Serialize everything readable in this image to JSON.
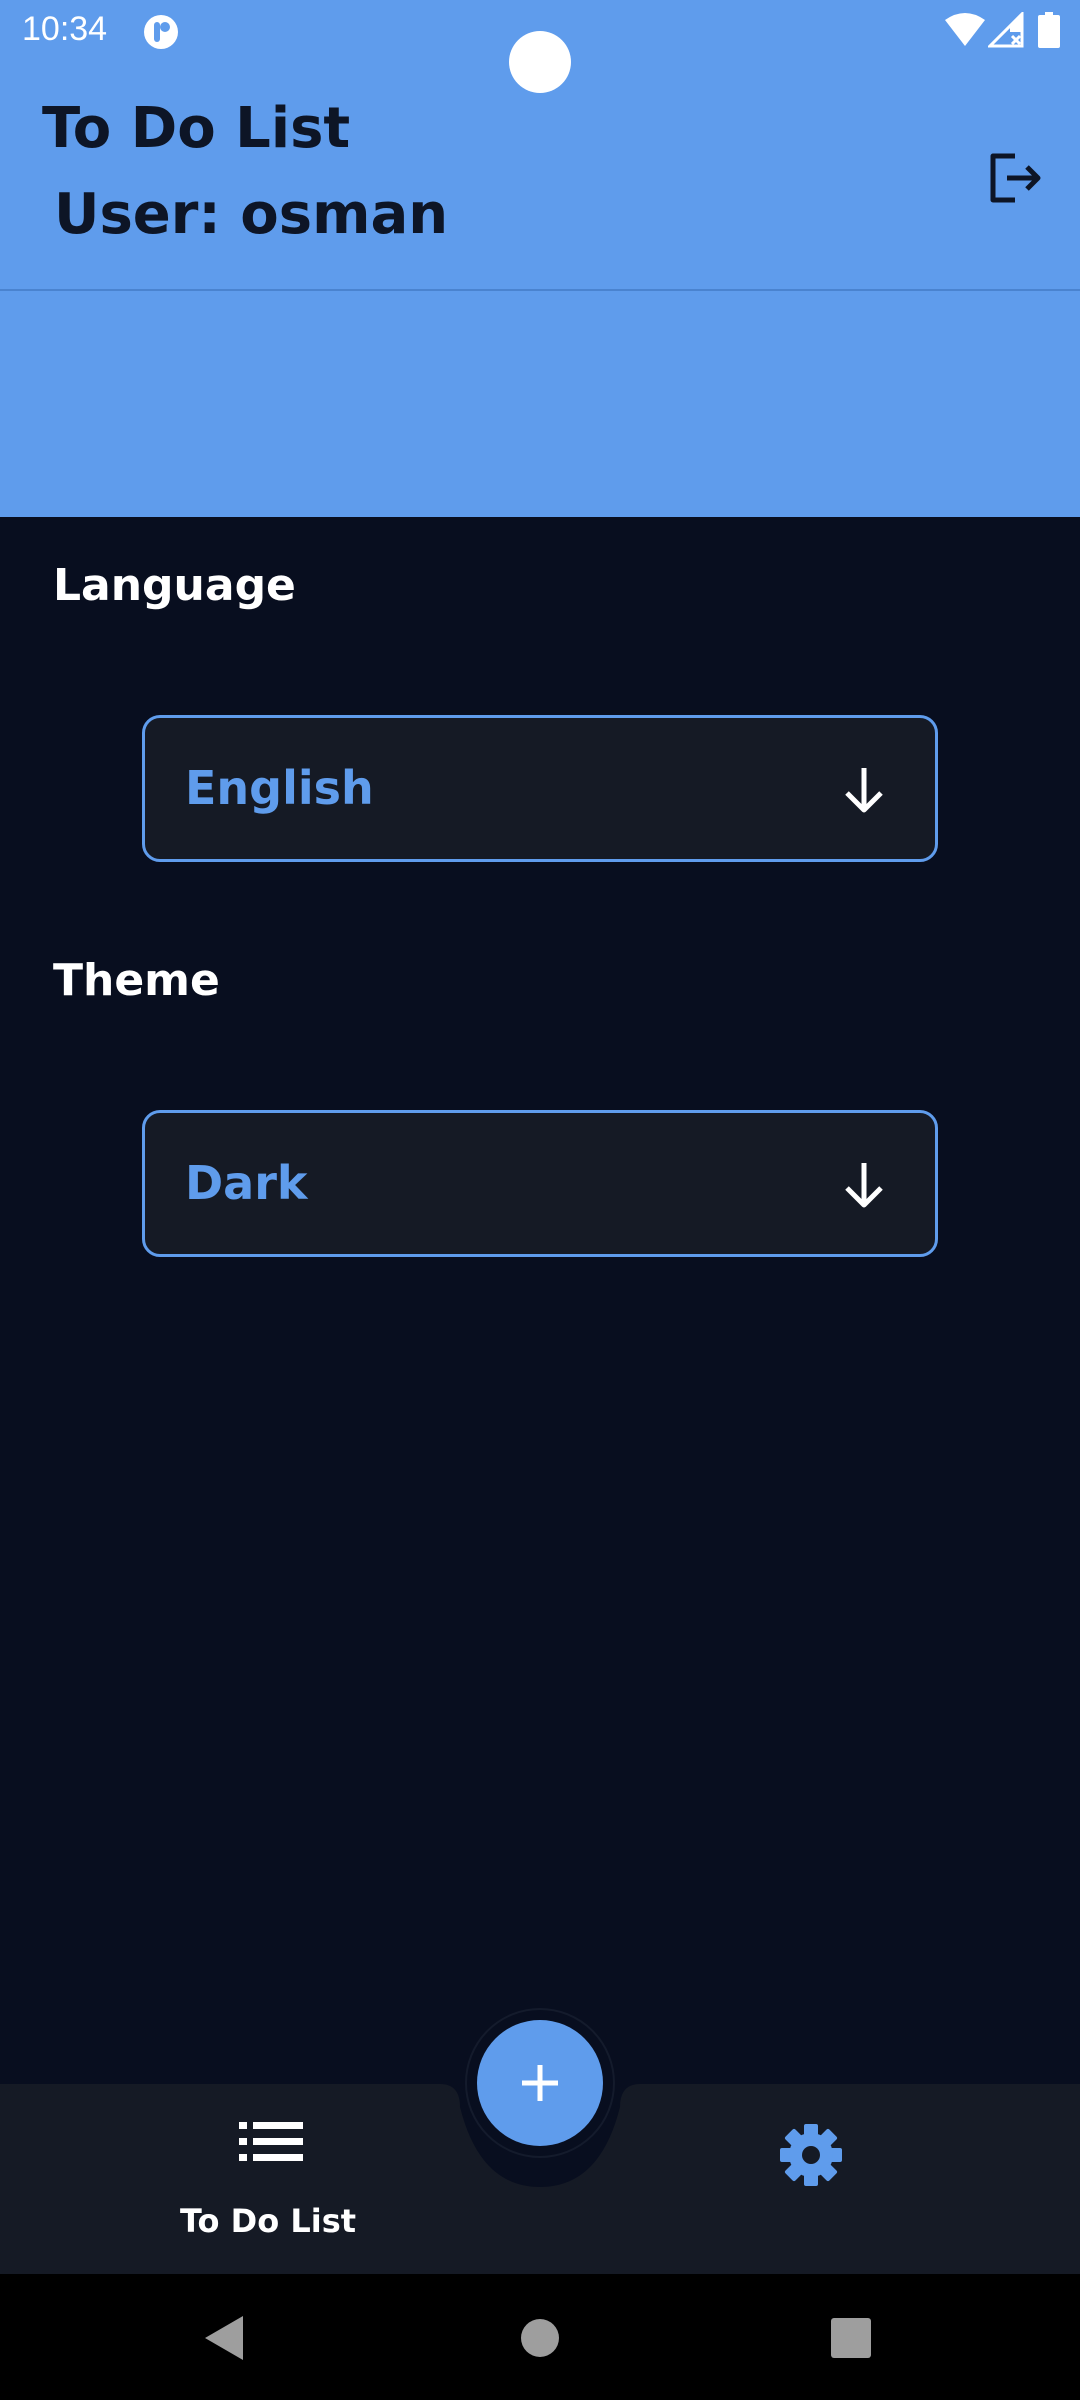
{
  "status_bar": {
    "time": "10:34",
    "icons": [
      "notification-app-icon",
      "wifi-icon",
      "signal-icon",
      "battery-icon"
    ]
  },
  "header": {
    "title": "To Do List",
    "user": "User: osman",
    "logout_icon": "logout-icon"
  },
  "settings": {
    "language": {
      "label": "Language",
      "value": "English"
    },
    "theme": {
      "label": "Theme",
      "value": "Dark"
    }
  },
  "bottom_nav": {
    "todo_label": "To Do List",
    "todo_icon": "list-icon",
    "fab_icon": "plus-icon",
    "settings_icon": "gear-icon"
  },
  "colors": {
    "accent": "#5F9CEC",
    "background": "#080E1F",
    "surface": "#151A25",
    "header_text": "#0D1526"
  }
}
